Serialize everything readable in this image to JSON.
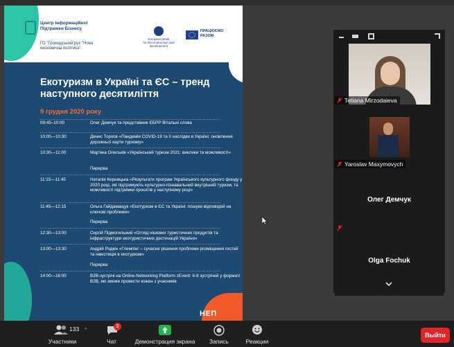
{
  "slide": {
    "org_name": "Центр Інформаційної Підтримки Бізнесу",
    "ngo_name": "ГО \"Громадський рух \"Нова економічна політика\"",
    "ebrd_name": "European Bank",
    "ebrd_sub": "for Reconstruction and Development",
    "eu_label": "ПРАЦЮЄМО РАЗОМ",
    "title": "Екотуризм в Україні та ЄС – тренд наступного десятиліття",
    "date": "9 грудня 2020 року",
    "program": [
      {
        "time": "09:45–10:00",
        "desc": "Олег Демчук та представник ЄБРР Вітальні слова"
      },
      {
        "time": "10:00—10:30",
        "desc": "Денис Торхов «Пандемія COVID-19 та її наслідки в Україні: оновлення дорожньої карти туризму»"
      },
      {
        "time": "10:30—11:00",
        "desc": "Мар'яна Олеськів «Український туризм 2021: виклики та можливості»"
      },
      {
        "time": "11:15—11:45",
        "desc": "Наталія Керницька «Результати програм Українського культурного фонду у 2020 році, які підтримують культурно-пізнавальний внутрішній туризм, та можливості підтримки проєктів у наступному році»"
      },
      {
        "time": "11:45—12:15",
        "desc": "Ольга Гайдамащук «Екотуризм в ЄС та Україні: пошуки відповідей на ключові проблеми»"
      },
      {
        "time": "12:30—13:00",
        "desc": "Сергій Підмогильний «Огляд нішевих туристичних продуктів та інфраструктури екотуристичних дестинацій України»"
      },
      {
        "time": "13:00—13:30",
        "desc": "Андрій Родкін «Глемпінг – сучасне рішення проблеми розміщення гостей та інвестиція в екотуризм»"
      },
      {
        "time": "14:00—16:00",
        "desc": "B2B-зустрічі на Online-Networking Platform zEvent: 6-8 зустрічей у форматі B2B, які зможе провести кожен з учасників"
      }
    ],
    "break_label": "Перерва",
    "badge": "НЕП"
  },
  "gallery": {
    "participants": [
      {
        "name": "Tetiana Mirzodaieva",
        "muted": true
      },
      {
        "name": "Yaroslav Maxymovych",
        "muted": true
      },
      {
        "name": "Олег Демчук",
        "muted": true
      },
      {
        "name": "Olga Fochuk",
        "muted": true
      }
    ]
  },
  "toolbar": {
    "participants_label": "Участники",
    "participants_count": "133",
    "chat_label": "Чат",
    "chat_badge": "3",
    "share_label": "Демонстрация экрана",
    "record_label": "Запись",
    "reactions_label": "Реакции",
    "leave_label": "Выйти"
  },
  "colors": {
    "slide_bg": "#1e4a72",
    "accent_orange": "#f26b3a",
    "accent_teal": "#2ec4a6",
    "share_green": "#22b14c",
    "leave_red": "#e0262a"
  }
}
